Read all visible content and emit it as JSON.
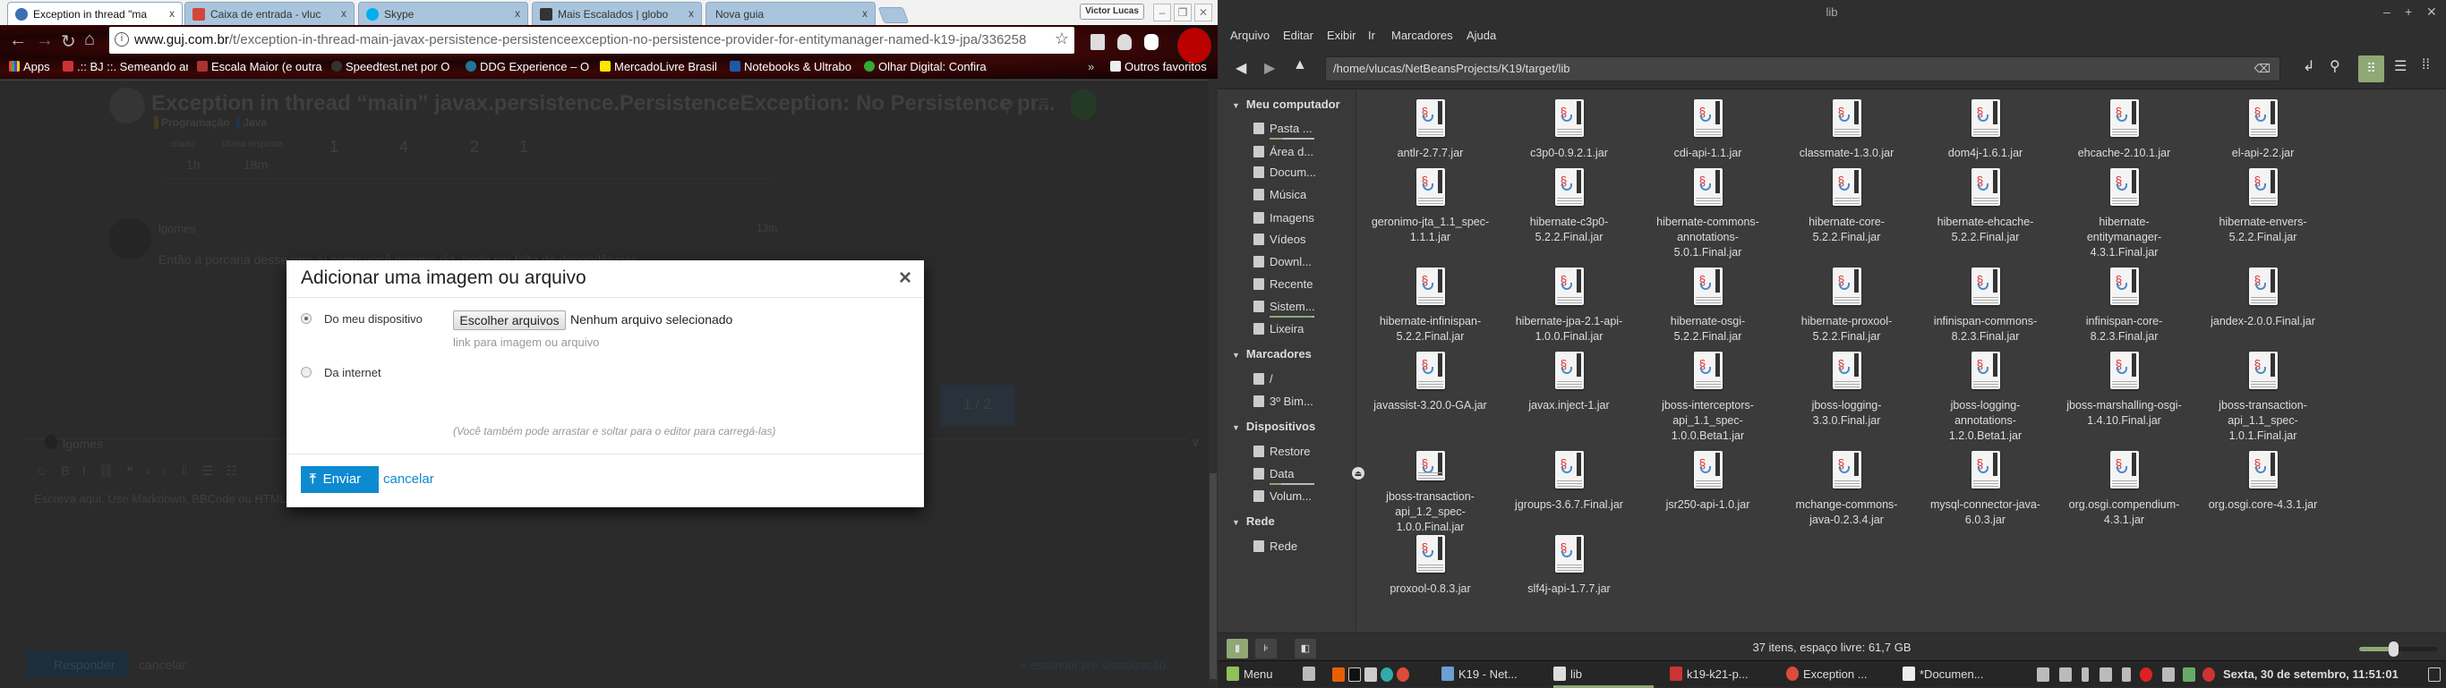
{
  "browser": {
    "tabs": [
      {
        "title": "Exception in thread \"ma",
        "close": "x",
        "color": "#3d6fb4"
      },
      {
        "title": "Caixa de entrada - vluc",
        "close": "x",
        "color": "#d44638"
      },
      {
        "title": "Skype",
        "close": "x",
        "color": "#00aff0"
      },
      {
        "title": "Mais Escalados | globo",
        "close": "x",
        "color": "#333333"
      },
      {
        "title": "Nova guia",
        "close": "x",
        "color": "#a9c5dd"
      }
    ],
    "profile": "Victor Lucas",
    "window_controls": [
      "–",
      "❐",
      "✕"
    ],
    "url_host": "www.guj.com.br",
    "url_path": "/t/exception-in-thread-main-javax-persistence-persistenceexception-no-persistence-provider-for-entitymanager-named-k19-jpa/336258",
    "bookmarks": [
      ".:: BJ ::. Semeando ar",
      "Escala Maior (e outra",
      "Speedtest.net por O",
      "DDG Experience – O",
      "MercadoLivre Brasil",
      "Notebooks & Ultrabo",
      "Olhar Digital: Confira"
    ],
    "apps": "Apps",
    "more": "»",
    "other_bookmarks": "Outros favoritos"
  },
  "topic": {
    "title": "Exception in thread “main” javax.persistence.PersistenceException: No Persistence pr...",
    "categories": [
      "Programação",
      "Java"
    ],
    "stats_labels": [
      "criado",
      "última resposta"
    ],
    "stats_times": [
      "1h",
      "18m"
    ],
    "stats_numbers": [
      "1",
      "4",
      "2",
      "1"
    ],
    "post_author": "lgomes",
    "post_time": "13m",
    "post_text": "Então a porcaria desse erro aí como você mesmo diz, pode ser falta de dependências",
    "progress": "1 / 2",
    "composer_user": "lgomes",
    "composer_placeholder": "Escreva aqui. Use Markdown, BBCode ou HTML...",
    "reply": "Responder",
    "cancel": "cancelar",
    "hide_preview": "« esconder pré-visualização"
  },
  "modal": {
    "title": "Adicionar uma imagem ou arquivo",
    "close": "×",
    "option_device": "Do meu dispositivo",
    "choose_files": "Escolher arquivos",
    "no_file": "Nenhum arquivo selecionado",
    "link_placeholder": "link para imagem ou arquivo",
    "option_internet": "Da internet",
    "hint": "(Você também pode arrastar e soltar para o editor para carregá-las)",
    "submit": "Enviar",
    "cancel": "cancelar",
    "accent": "#0e8ad0"
  },
  "fm": {
    "title": "lib",
    "menu": [
      "Arquivo",
      "Editar",
      "Exibir",
      "Ir",
      "Marcadores",
      "Ajuda"
    ],
    "path": "/home/vlucas/NetBeansProjects/K19/target/lib",
    "sidebar": [
      {
        "type": "head",
        "label": "Meu computador"
      },
      {
        "type": "item",
        "label": "Pasta ...",
        "usage": 0.3
      },
      {
        "type": "item",
        "label": "Área d..."
      },
      {
        "type": "item",
        "label": "Docum..."
      },
      {
        "type": "item",
        "label": "Música"
      },
      {
        "type": "item",
        "label": "Imagens"
      },
      {
        "type": "item",
        "label": "Vídeos"
      },
      {
        "type": "item",
        "label": "Downl..."
      },
      {
        "type": "item",
        "label": "Recente"
      },
      {
        "type": "item",
        "label": "Sistem...",
        "usage": 0.95
      },
      {
        "type": "item",
        "label": "Lixeira"
      },
      {
        "type": "head",
        "label": "Marcadores"
      },
      {
        "type": "item",
        "label": "/"
      },
      {
        "type": "item",
        "label": "3º Bim..."
      },
      {
        "type": "head",
        "label": "Dispositivos"
      },
      {
        "type": "item",
        "label": "Restore"
      },
      {
        "type": "item",
        "label": "Data",
        "usage": 0.25,
        "eject": true
      },
      {
        "type": "item",
        "label": "Volum..."
      },
      {
        "type": "head",
        "label": "Rede"
      },
      {
        "type": "item",
        "label": "Rede"
      }
    ],
    "files": [
      "antlr-2.7.7.jar",
      "c3p0-0.9.2.1.jar",
      "cdi-api-1.1.jar",
      "classmate-1.3.0.jar",
      "dom4j-1.6.1.jar",
      "ehcache-2.10.1.jar",
      "el-api-2.2.jar",
      "geronimo-jta_1.1_spec-1.1.1.jar",
      "hibernate-c3p0-5.2.2.Final.jar",
      "hibernate-commons-annotations-5.0.1.Final.jar",
      "hibernate-core-5.2.2.Final.jar",
      "hibernate-ehcache-5.2.2.Final.jar",
      "hibernate-entitymanager-4.3.1.Final.jar",
      "hibernate-envers-5.2.2.Final.jar",
      "hibernate-infinispan-5.2.2.Final.jar",
      "hibernate-jpa-2.1-api-1.0.0.Final.jar",
      "hibernate-osgi-5.2.2.Final.jar",
      "hibernate-proxool-5.2.2.Final.jar",
      "infinispan-commons-8.2.3.Final.jar",
      "infinispan-core-8.2.3.Final.jar",
      "jandex-2.0.0.Final.jar",
      "javassist-3.20.0-GA.jar",
      "javax.inject-1.jar",
      "jboss-interceptors-api_1.1_spec-1.0.0.Beta1.jar",
      "jboss-logging-3.3.0.Final.jar",
      "jboss-logging-annotations-1.2.0.Beta1.jar",
      "jboss-marshalling-osgi-1.4.10.Final.jar",
      "jboss-transaction-api_1.1_spec-1.0.1.Final.jar",
      "jboss-transaction-api_1.2_spec-1.0.0.Final.jar",
      "jgroups-3.6.7.Final.jar",
      "jsr250-api-1.0.jar",
      "mchange-commons-java-0.2.3.4.jar",
      "mysql-connector-java-6.0.3.jar",
      "org.osgi.compendium-4.3.1.jar",
      "org.osgi.core-4.3.1.jar",
      "proxool-0.8.3.jar",
      "slf4j-api-1.7.7.jar"
    ],
    "status": "37 itens, espaço livre: 61,7 GB",
    "zoom_level": 0.45,
    "accent": "#8fa876"
  },
  "taskbar": {
    "menu": "Menu",
    "windows": [
      "K19 - Net...",
      "lib",
      "k19-k21-p...",
      "Exception ...",
      "*Documen..."
    ],
    "clock": "Sexta, 30 de setembro, 11:51:01"
  }
}
